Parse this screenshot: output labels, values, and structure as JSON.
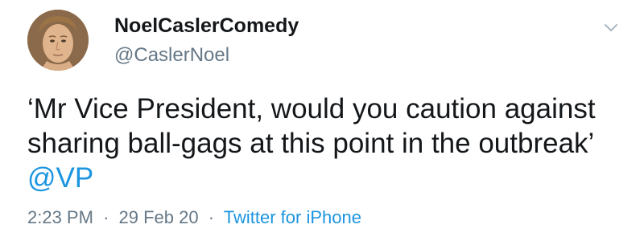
{
  "author": {
    "display_name": "NoelCaslerComedy",
    "handle": "@CaslerNoel"
  },
  "tweet": {
    "line1": "‘Mr Vice President, would you caution against",
    "line2": "sharing ball-gags at this point in the outbreak’",
    "mention": "@VP"
  },
  "meta": {
    "time": "2:23 PM",
    "separator": "·",
    "date": "29 Feb 20",
    "source": "Twitter for iPhone"
  },
  "icons": {
    "caret": "chevron-down-icon"
  },
  "colors": {
    "text": "#14171a",
    "secondary": "#657786",
    "link": "#1b95e0"
  }
}
